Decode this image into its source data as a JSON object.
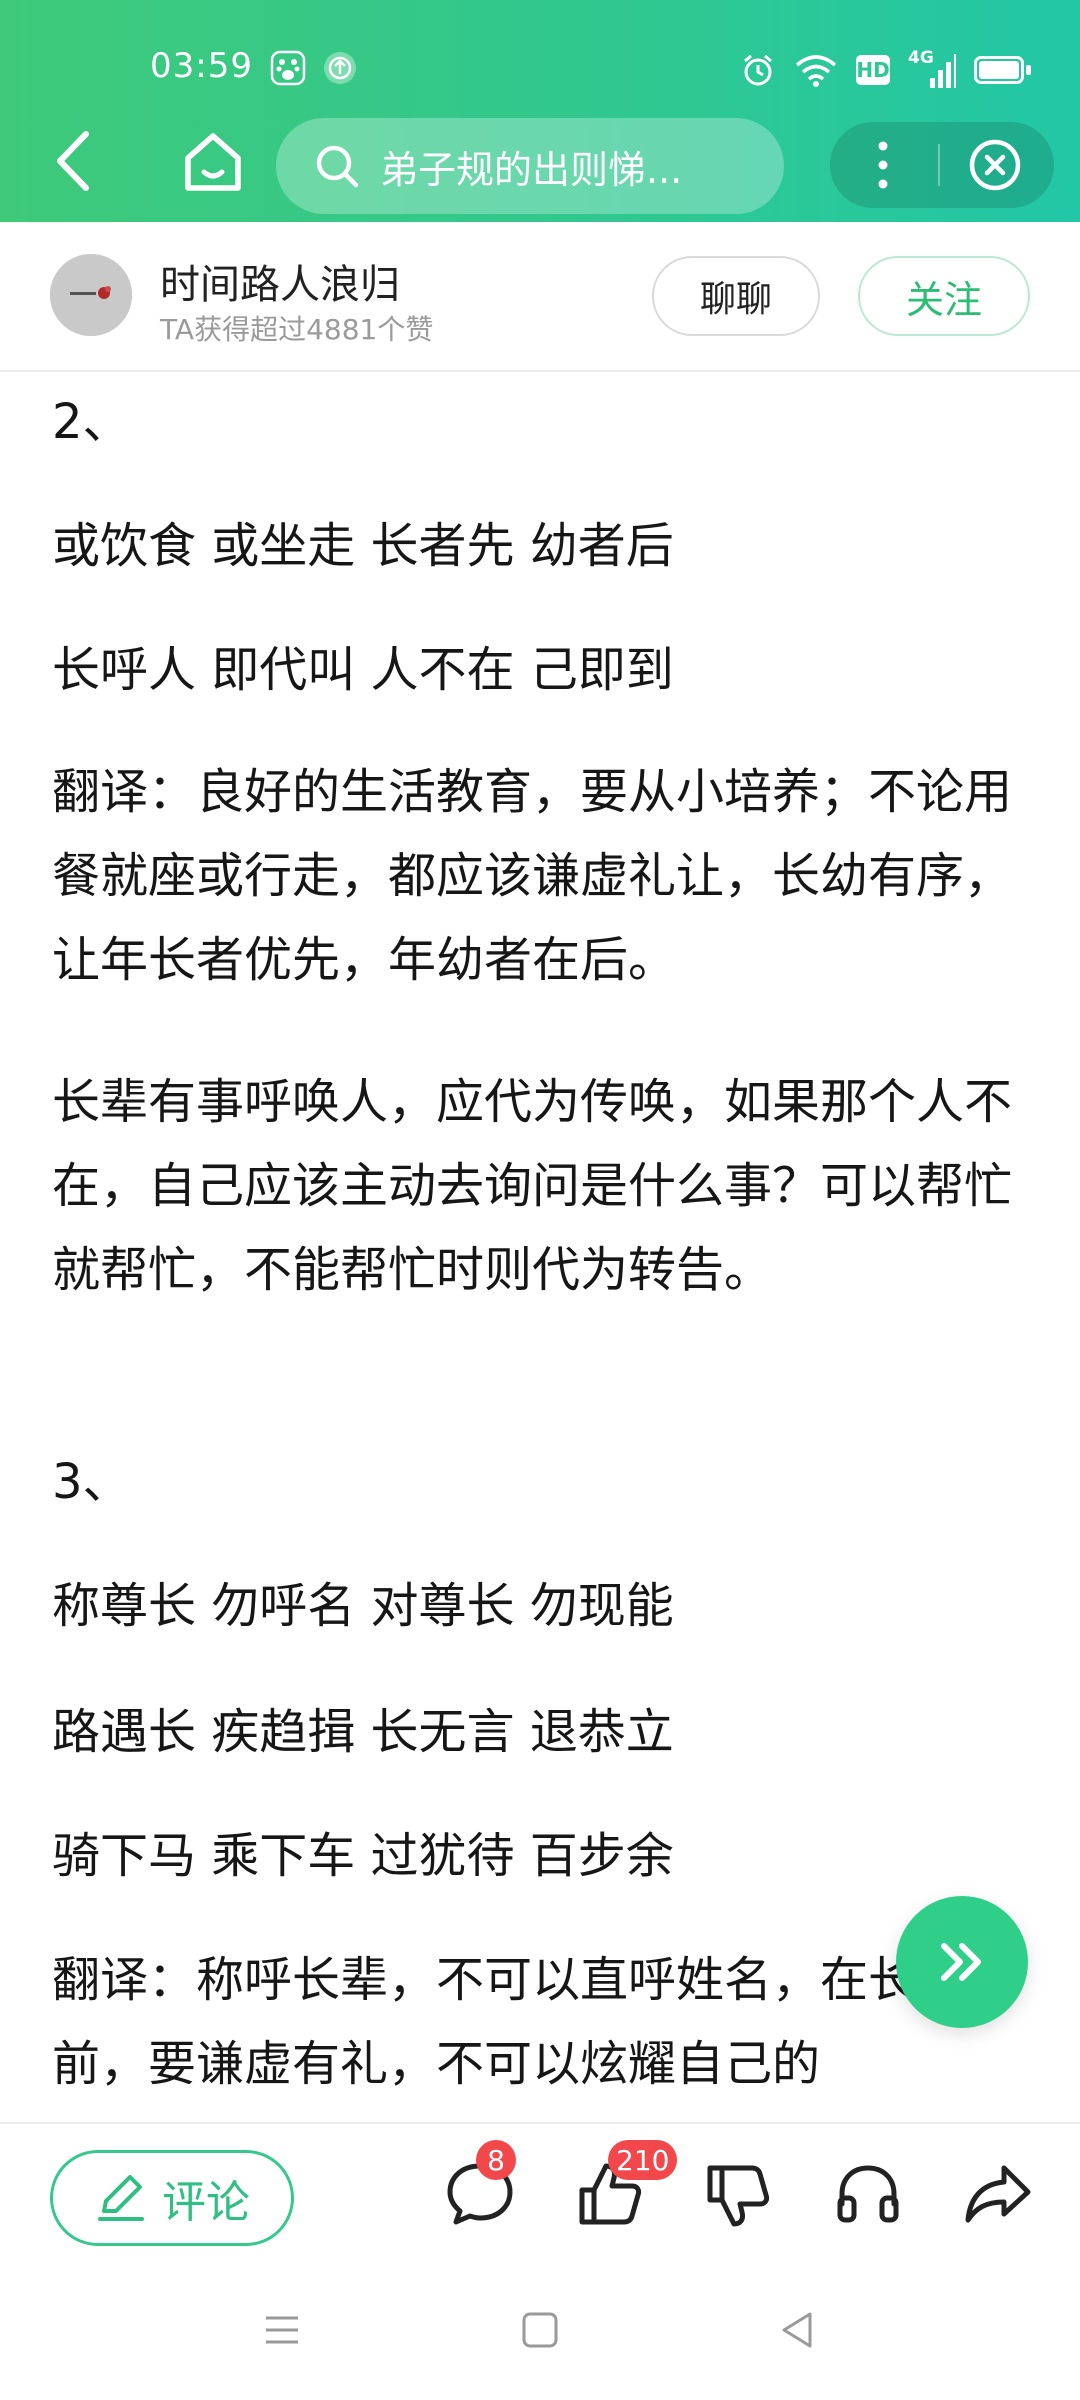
{
  "status_bar": {
    "time": "03:59",
    "icons_left": [
      "baidu-paw-icon",
      "upload-circle-icon"
    ],
    "icons_right": [
      "alarm-icon",
      "wifi-icon",
      "hd-icon",
      "signal-4g-icon",
      "battery-icon"
    ],
    "hd_label": "HD",
    "network_label": "4G"
  },
  "nav": {
    "search_text": "弟子规的出则悌..."
  },
  "author": {
    "name": "时间路人浪归",
    "stats": "TA获得超过4881个赞",
    "chat_label": "聊聊",
    "follow_label": "关注"
  },
  "article": {
    "paragraphs": [
      "2、",
      "或饮食 或坐走 长者先 幼者后",
      "长呼人 即代叫 人不在 己即到",
      "翻译：良好的生活教育，要从小培养；不论用餐就座或行走，都应该谦虚礼让，长幼有序，让年长者优先，年幼者在后。",
      "长辈有事呼唤人，应代为传唤，如果那个人不在，自己应该主动去询问是什么事？可以帮忙就帮忙，不能帮忙时则代为转告。",
      "3、",
      "称尊长 勿呼名 对尊长 勿现能",
      "路遇长 疾趋揖 长无言 退恭立",
      "骑下马 乘下车 过犹待 百步余",
      "翻译：称呼长辈，不可以直呼姓名，在长辈面前，要谦虚有礼，不可以炫耀自己的"
    ]
  },
  "bottom_bar": {
    "comment_label": "评论",
    "comments_count": "8",
    "likes_count": "210"
  },
  "colors": {
    "header_gradient_start": "#3ec97a",
    "header_gradient_end": "#22c7a6",
    "accent_green": "#2fbf82",
    "badge_red": "#f2484b"
  }
}
